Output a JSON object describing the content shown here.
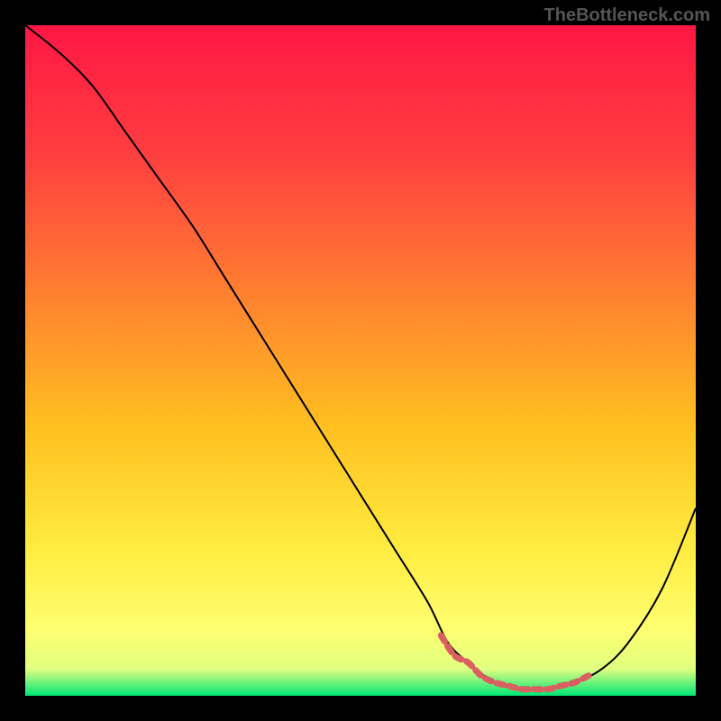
{
  "watermark": "TheBottleneck.com",
  "chart_data": {
    "type": "line",
    "title": "",
    "xlabel": "",
    "ylabel": "",
    "xlim": [
      0,
      100
    ],
    "ylim": [
      0,
      100
    ],
    "series": [
      {
        "name": "curve",
        "x": [
          0,
          5,
          10,
          15,
          20,
          25,
          30,
          35,
          40,
          45,
          50,
          55,
          60,
          63,
          66,
          70,
          74,
          78,
          82,
          86,
          90,
          95,
          100
        ],
        "y": [
          100,
          96,
          91,
          84,
          77,
          70,
          62,
          54,
          46,
          38,
          30,
          22,
          14,
          8,
          5,
          2,
          1,
          1,
          2,
          4,
          8,
          16,
          28
        ]
      },
      {
        "name": "highlight",
        "x": [
          62,
          64,
          66,
          68,
          70,
          72,
          74,
          76,
          78,
          80,
          82,
          84
        ],
        "y": [
          9,
          6,
          5,
          3,
          2,
          1.5,
          1,
          1,
          1,
          1.5,
          2,
          3
        ]
      }
    ],
    "gradient_stops": [
      {
        "offset": 0,
        "color": "#ff1744"
      },
      {
        "offset": 20,
        "color": "#ff4040"
      },
      {
        "offset": 40,
        "color": "#ff8030"
      },
      {
        "offset": 60,
        "color": "#ffc020"
      },
      {
        "offset": 78,
        "color": "#ffec40"
      },
      {
        "offset": 90,
        "color": "#ffff70"
      },
      {
        "offset": 96,
        "color": "#e0ff80"
      },
      {
        "offset": 100,
        "color": "#00e676"
      }
    ]
  }
}
